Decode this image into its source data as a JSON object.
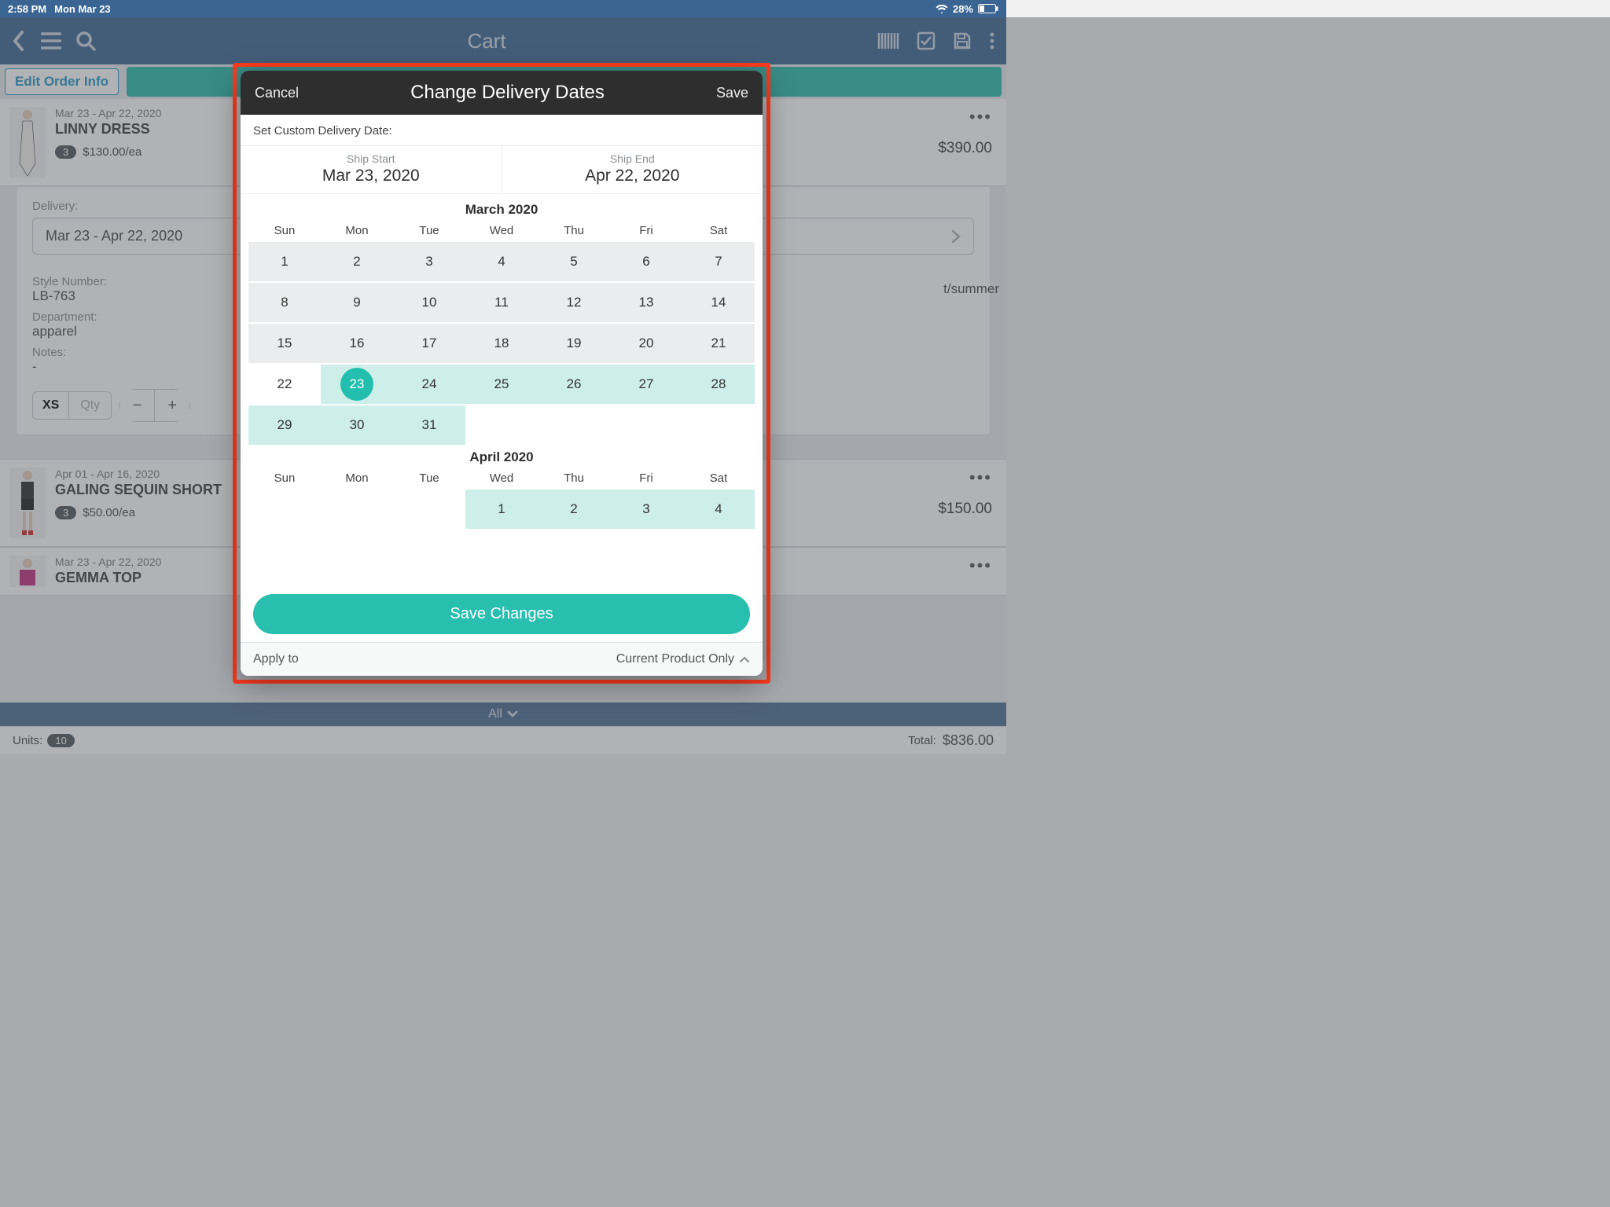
{
  "status": {
    "time": "2:58 PM",
    "date": "Mon Mar 23",
    "battery": "28%"
  },
  "header": {
    "title": "Cart"
  },
  "order_bar": {
    "edit_button": "Edit Order Info"
  },
  "products": [
    {
      "dates": "Mar 23 - Apr 22, 2020",
      "name": "LINNY DRESS",
      "qty_pill": "3",
      "price_each": "$130.00/ea",
      "line_total": "$390.00"
    },
    {
      "dates": "Apr 01 - Apr 16, 2020",
      "name": "GALING SEQUIN SHORT",
      "qty_pill": "3",
      "price_each": "$50.00/ea",
      "line_total": "$150.00"
    },
    {
      "dates": "Mar 23 - Apr 22, 2020",
      "name": "GEMMA TOP"
    }
  ],
  "detail": {
    "delivery_label": "Delivery:",
    "delivery_value": "Mar 23 - Apr 22, 2020",
    "style_number_label": "Style Number:",
    "style_number": "LB-763",
    "department_label": "Department:",
    "department": "apparel",
    "notes_label": "Notes:",
    "notes": "-",
    "season_suffix": "t/summer",
    "size_label": "XS",
    "qty_placeholder": "Qty"
  },
  "filter_bar": {
    "label": "All"
  },
  "footer": {
    "units_label": "Units:",
    "units": "10",
    "total_label": "Total:",
    "total": "$836.00"
  },
  "modal": {
    "cancel": "Cancel",
    "title": "Change Delivery Dates",
    "save": "Save",
    "custom_label": "Set Custom Delivery Date:",
    "ship_start_label": "Ship Start",
    "ship_start": "Mar 23, 2020",
    "ship_end_label": "Ship End",
    "ship_end": "Apr 22, 2020",
    "dow": [
      "Sun",
      "Mon",
      "Tue",
      "Wed",
      "Thu",
      "Fri",
      "Sat"
    ],
    "month1": {
      "title": "March 2020",
      "rows": [
        [
          {
            "n": "1",
            "dim": true
          },
          {
            "n": "2",
            "dim": true
          },
          {
            "n": "3",
            "dim": true
          },
          {
            "n": "4",
            "dim": true
          },
          {
            "n": "5",
            "dim": true
          },
          {
            "n": "6",
            "dim": true
          },
          {
            "n": "7",
            "dim": true
          }
        ],
        [
          {
            "n": "8",
            "dim": true
          },
          {
            "n": "9",
            "dim": true
          },
          {
            "n": "10",
            "dim": true
          },
          {
            "n": "11",
            "dim": true
          },
          {
            "n": "12",
            "dim": true
          },
          {
            "n": "13",
            "dim": true
          },
          {
            "n": "14",
            "dim": true
          }
        ],
        [
          {
            "n": "15",
            "dim": true
          },
          {
            "n": "16",
            "dim": true
          },
          {
            "n": "17",
            "dim": true
          },
          {
            "n": "18",
            "dim": true
          },
          {
            "n": "19",
            "dim": true
          },
          {
            "n": "20",
            "dim": true
          },
          {
            "n": "21",
            "dim": true
          }
        ],
        [
          {
            "n": "22"
          },
          {
            "n": "23",
            "selected": true,
            "range": true
          },
          {
            "n": "24",
            "range": true
          },
          {
            "n": "25",
            "range": true
          },
          {
            "n": "26",
            "range": true
          },
          {
            "n": "27",
            "range": true
          },
          {
            "n": "28",
            "range": true
          }
        ],
        [
          {
            "n": "29",
            "range": true
          },
          {
            "n": "30",
            "range": true
          },
          {
            "n": "31",
            "range": true
          },
          {
            "empty": true
          },
          {
            "empty": true
          },
          {
            "empty": true
          },
          {
            "empty": true
          }
        ]
      ]
    },
    "month2": {
      "title": "April 2020",
      "rows": [
        [
          {
            "empty": true
          },
          {
            "empty": true
          },
          {
            "empty": true
          },
          {
            "n": "1",
            "range": true
          },
          {
            "n": "2",
            "range": true
          },
          {
            "n": "3",
            "range": true
          },
          {
            "n": "4",
            "range": true
          }
        ]
      ]
    },
    "save_changes": "Save Changes",
    "apply_label": "Apply to",
    "apply_value": "Current Product Only"
  }
}
